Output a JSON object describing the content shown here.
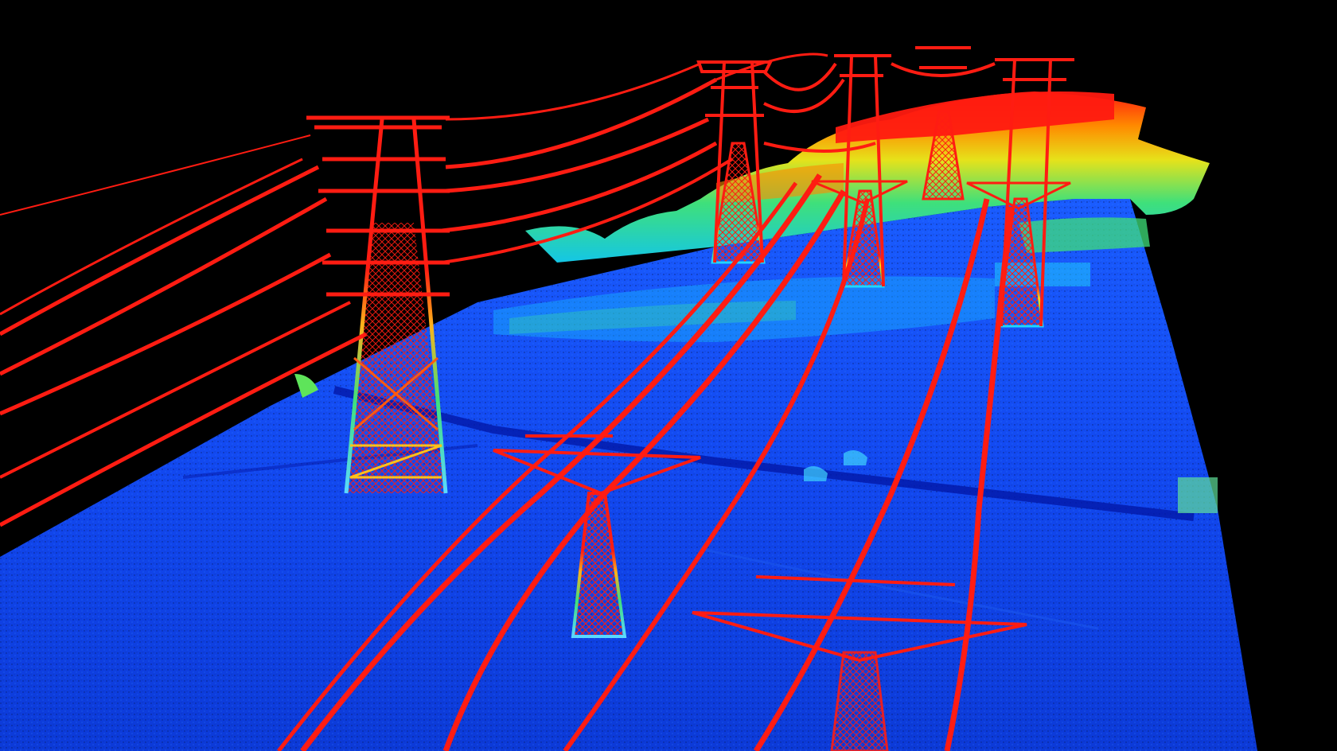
{
  "scene": {
    "subject": "lidar-point-cloud-power-lines",
    "palette": {
      "background": "#000000",
      "ground_low": "#0a2fe0",
      "ground_mid": "#1e6dff",
      "vegetation_low": "#13c8e8",
      "vegetation_mid": "#3fe07a",
      "vegetation_high": "#e6e21a",
      "elevated": "#ff8a00",
      "highest": "#ff1a10",
      "conductor": "#ff1c12"
    }
  }
}
